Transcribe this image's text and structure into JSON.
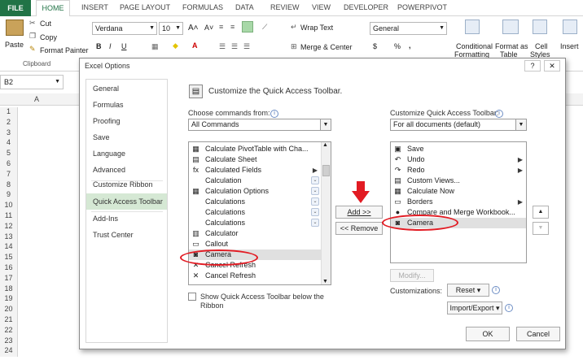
{
  "ribbon": {
    "tabs": [
      "FILE",
      "HOME",
      "INSERT",
      "PAGE LAYOUT",
      "FORMULAS",
      "DATA",
      "REVIEW",
      "VIEW",
      "DEVELOPER",
      "POWERPIVOT"
    ],
    "paste_label": "Paste",
    "cut_label": "Cut",
    "copy_label": "Copy",
    "format_painter_label": "Format Painter",
    "clipboard_label": "Clipboard",
    "font_name": "Verdana",
    "font_size": "10",
    "bold": "B",
    "italic": "I",
    "underline": "U",
    "wrap_text_label": "Wrap Text",
    "merge_center_label": "Merge & Center",
    "number_format": "General",
    "currency_symbol": "$",
    "percent_symbol": "%",
    "comma_symbol": ",",
    "conditional_formatting_label_1": "Conditional",
    "conditional_formatting_label_2": "Formatting",
    "format_as_table_label_1": "Format as",
    "format_as_table_label_2": "Table",
    "cell_styles_label_1": "Cell",
    "cell_styles_label_2": "Styles",
    "insert_label": "Insert"
  },
  "sheet": {
    "name_box": "B2",
    "column_a": "A",
    "rows": [
      "1",
      "2",
      "3",
      "4",
      "5",
      "6",
      "7",
      "8",
      "9",
      "10",
      "11",
      "12",
      "13",
      "14",
      "15",
      "16",
      "17",
      "18",
      "19",
      "20",
      "21",
      "22",
      "23",
      "24"
    ]
  },
  "dialog": {
    "title": "Excel Options",
    "help_button": "?",
    "close_button": "✕",
    "nav": [
      "General",
      "Formulas",
      "Proofing",
      "Save",
      "Language",
      "Advanced",
      "Customize Ribbon",
      "Quick Access Toolbar",
      "Add-Ins",
      "Trust Center"
    ],
    "heading": "Customize the Quick Access Toolbar.",
    "choose_label": "Choose commands from:",
    "choose_value": "All Commands",
    "customize_label": "Customize Quick Access Toolbar:",
    "customize_value": "For all documents (default)",
    "commands": [
      {
        "icon": "▦",
        "label": "Calculate PivotTable with Cha..."
      },
      {
        "icon": "▤",
        "label": "Calculate Sheet"
      },
      {
        "icon": "fx",
        "label": "Calculated Fields",
        "sub": "▶"
      },
      {
        "icon": "",
        "label": "Calculation",
        "exp": "⌄"
      },
      {
        "icon": "▦",
        "label": "Calculation Options",
        "exp": "⌄"
      },
      {
        "icon": "",
        "label": "Calculations",
        "exp": "⌄"
      },
      {
        "icon": "",
        "label": "Calculations",
        "exp": "⌄"
      },
      {
        "icon": "",
        "label": "Calculations",
        "exp": "⌄"
      },
      {
        "icon": "▥",
        "label": "Calculator"
      },
      {
        "icon": "▭",
        "label": "Callout"
      },
      {
        "icon": "◙",
        "label": "Camera"
      },
      {
        "icon": "✕",
        "label": "Cancel Refresh"
      },
      {
        "icon": "✕",
        "label": "Cancel Refresh"
      }
    ],
    "toolbar_items": [
      {
        "icon": "▣",
        "label": "Save"
      },
      {
        "icon": "↶",
        "label": "Undo",
        "sub": "▶"
      },
      {
        "icon": "↷",
        "label": "Redo",
        "sub": "▶"
      },
      {
        "icon": "▤",
        "label": "Custom Views..."
      },
      {
        "icon": "▦",
        "label": "Calculate Now"
      },
      {
        "icon": "▭",
        "label": "Borders",
        "sub": "▶"
      },
      {
        "icon": "●",
        "label": "Compare and Merge Workbook..."
      },
      {
        "icon": "◙",
        "label": "Camera"
      }
    ],
    "add_button": "Add >>",
    "remove_button": "<< Remove",
    "move_up": "▲",
    "move_down": "▼",
    "modify_button": "Modify...",
    "show_below_label_1": "Show Quick Access Toolbar below the",
    "show_below_label_2": "Ribbon",
    "customizations_label": "Customizations:",
    "reset_button": "Reset ▾",
    "import_export_button": "Import/Export ▾",
    "ok_button": "OK",
    "cancel_button": "Cancel"
  },
  "colors": {
    "excel_green": "#217346",
    "selected_nav": "#d5e8d4",
    "annotation_red": "#e21b23"
  }
}
